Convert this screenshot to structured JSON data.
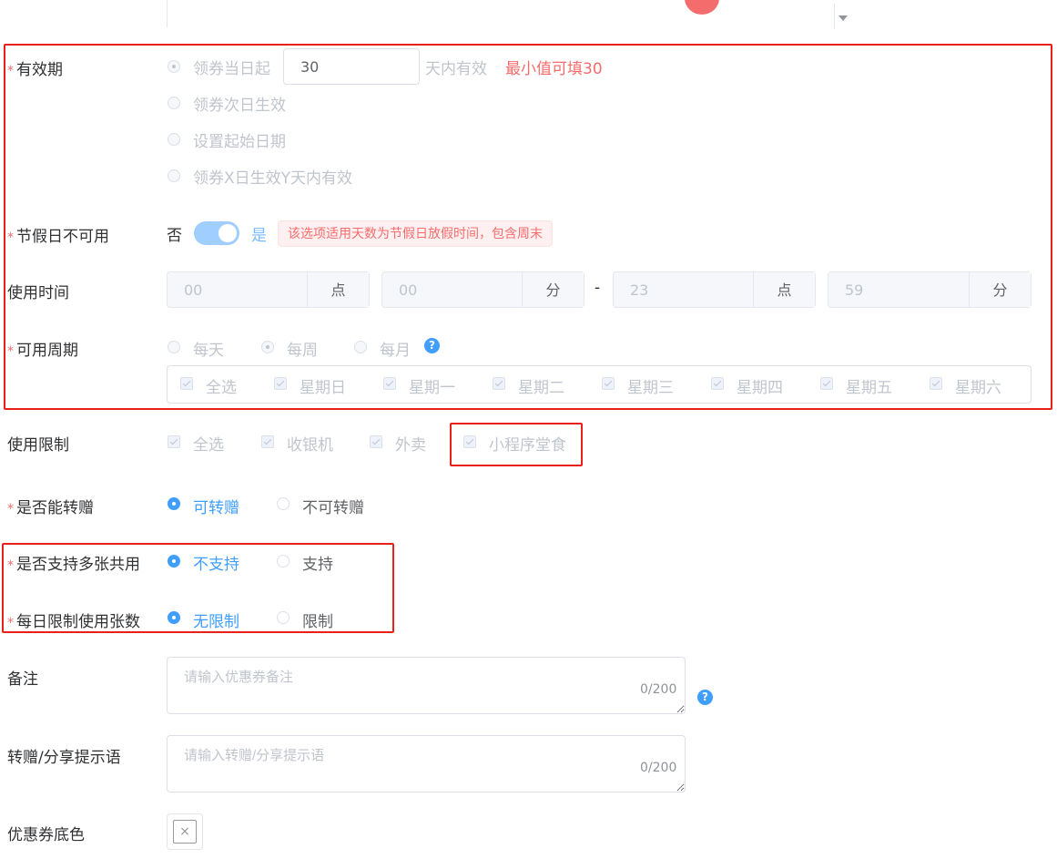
{
  "validity": {
    "label": "有效期",
    "options": [
      "领券当日起",
      "领券次日生效",
      "设置起始日期",
      "领券X日生效Y天内有效"
    ],
    "days_value": "30",
    "days_suffix": "天内有效",
    "hint": "最小值可填30"
  },
  "holiday": {
    "label": "节假日不可用",
    "off_text": "否",
    "on_text": "是",
    "on": true,
    "tip": "该选项适用天数为节假日放假时间，包含周末"
  },
  "use_time": {
    "label": "使用时间",
    "start_hour": "00",
    "start_minute": "00",
    "end_hour": "23",
    "end_minute": "59",
    "hour_unit": "点",
    "minute_unit": "分",
    "separator": "-"
  },
  "period": {
    "label": "可用周期",
    "options": [
      "每天",
      "每周",
      "每月"
    ],
    "selected": "每周",
    "days": [
      "全选",
      "星期日",
      "星期一",
      "星期二",
      "星期三",
      "星期四",
      "星期五",
      "星期六"
    ]
  },
  "usage_limit": {
    "label": "使用限制",
    "options": [
      "全选",
      "收银机",
      "外卖",
      "小程序堂食"
    ]
  },
  "transfer": {
    "label": "是否能转赠",
    "options": [
      "可转赠",
      "不可转赠"
    ],
    "selected": "可转赠"
  },
  "multi_use": {
    "label": "是否支持多张共用",
    "options": [
      "不支持",
      "支持"
    ],
    "selected": "不支持"
  },
  "daily_limit": {
    "label": "每日限制使用张数",
    "options": [
      "无限制",
      "限制"
    ],
    "selected": "无限制"
  },
  "remark": {
    "label": "备注",
    "placeholder": "请输入优惠券备注",
    "count": "0/200"
  },
  "share_tip": {
    "label": "转赠/分享提示语",
    "placeholder": "请输入转赠/分享提示语",
    "count": "0/200"
  },
  "bg_color": {
    "label": "优惠券底色",
    "clear_symbol": "×"
  },
  "help_symbol": "?",
  "required_mark": "*",
  "colors": {
    "primary": "#409eff",
    "danger": "#f56c6c",
    "highlight_box": "#e8201a",
    "disabled_text": "#c0c4cc"
  }
}
